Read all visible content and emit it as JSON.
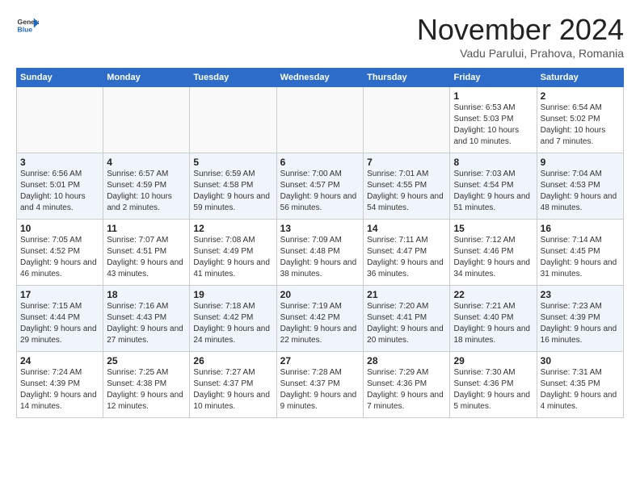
{
  "logo": {
    "general": "General",
    "blue": "Blue"
  },
  "header": {
    "month": "November 2024",
    "location": "Vadu Parului, Prahova, Romania"
  },
  "weekdays": [
    "Sunday",
    "Monday",
    "Tuesday",
    "Wednesday",
    "Thursday",
    "Friday",
    "Saturday"
  ],
  "weeks": [
    [
      {
        "day": "",
        "info": ""
      },
      {
        "day": "",
        "info": ""
      },
      {
        "day": "",
        "info": ""
      },
      {
        "day": "",
        "info": ""
      },
      {
        "day": "",
        "info": ""
      },
      {
        "day": "1",
        "info": "Sunrise: 6:53 AM\nSunset: 5:03 PM\nDaylight: 10 hours and 10 minutes."
      },
      {
        "day": "2",
        "info": "Sunrise: 6:54 AM\nSunset: 5:02 PM\nDaylight: 10 hours and 7 minutes."
      }
    ],
    [
      {
        "day": "3",
        "info": "Sunrise: 6:56 AM\nSunset: 5:01 PM\nDaylight: 10 hours and 4 minutes."
      },
      {
        "day": "4",
        "info": "Sunrise: 6:57 AM\nSunset: 4:59 PM\nDaylight: 10 hours and 2 minutes."
      },
      {
        "day": "5",
        "info": "Sunrise: 6:59 AM\nSunset: 4:58 PM\nDaylight: 9 hours and 59 minutes."
      },
      {
        "day": "6",
        "info": "Sunrise: 7:00 AM\nSunset: 4:57 PM\nDaylight: 9 hours and 56 minutes."
      },
      {
        "day": "7",
        "info": "Sunrise: 7:01 AM\nSunset: 4:55 PM\nDaylight: 9 hours and 54 minutes."
      },
      {
        "day": "8",
        "info": "Sunrise: 7:03 AM\nSunset: 4:54 PM\nDaylight: 9 hours and 51 minutes."
      },
      {
        "day": "9",
        "info": "Sunrise: 7:04 AM\nSunset: 4:53 PM\nDaylight: 9 hours and 48 minutes."
      }
    ],
    [
      {
        "day": "10",
        "info": "Sunrise: 7:05 AM\nSunset: 4:52 PM\nDaylight: 9 hours and 46 minutes."
      },
      {
        "day": "11",
        "info": "Sunrise: 7:07 AM\nSunset: 4:51 PM\nDaylight: 9 hours and 43 minutes."
      },
      {
        "day": "12",
        "info": "Sunrise: 7:08 AM\nSunset: 4:49 PM\nDaylight: 9 hours and 41 minutes."
      },
      {
        "day": "13",
        "info": "Sunrise: 7:09 AM\nSunset: 4:48 PM\nDaylight: 9 hours and 38 minutes."
      },
      {
        "day": "14",
        "info": "Sunrise: 7:11 AM\nSunset: 4:47 PM\nDaylight: 9 hours and 36 minutes."
      },
      {
        "day": "15",
        "info": "Sunrise: 7:12 AM\nSunset: 4:46 PM\nDaylight: 9 hours and 34 minutes."
      },
      {
        "day": "16",
        "info": "Sunrise: 7:14 AM\nSunset: 4:45 PM\nDaylight: 9 hours and 31 minutes."
      }
    ],
    [
      {
        "day": "17",
        "info": "Sunrise: 7:15 AM\nSunset: 4:44 PM\nDaylight: 9 hours and 29 minutes."
      },
      {
        "day": "18",
        "info": "Sunrise: 7:16 AM\nSunset: 4:43 PM\nDaylight: 9 hours and 27 minutes."
      },
      {
        "day": "19",
        "info": "Sunrise: 7:18 AM\nSunset: 4:42 PM\nDaylight: 9 hours and 24 minutes."
      },
      {
        "day": "20",
        "info": "Sunrise: 7:19 AM\nSunset: 4:42 PM\nDaylight: 9 hours and 22 minutes."
      },
      {
        "day": "21",
        "info": "Sunrise: 7:20 AM\nSunset: 4:41 PM\nDaylight: 9 hours and 20 minutes."
      },
      {
        "day": "22",
        "info": "Sunrise: 7:21 AM\nSunset: 4:40 PM\nDaylight: 9 hours and 18 minutes."
      },
      {
        "day": "23",
        "info": "Sunrise: 7:23 AM\nSunset: 4:39 PM\nDaylight: 9 hours and 16 minutes."
      }
    ],
    [
      {
        "day": "24",
        "info": "Sunrise: 7:24 AM\nSunset: 4:39 PM\nDaylight: 9 hours and 14 minutes."
      },
      {
        "day": "25",
        "info": "Sunrise: 7:25 AM\nSunset: 4:38 PM\nDaylight: 9 hours and 12 minutes."
      },
      {
        "day": "26",
        "info": "Sunrise: 7:27 AM\nSunset: 4:37 PM\nDaylight: 9 hours and 10 minutes."
      },
      {
        "day": "27",
        "info": "Sunrise: 7:28 AM\nSunset: 4:37 PM\nDaylight: 9 hours and 9 minutes."
      },
      {
        "day": "28",
        "info": "Sunrise: 7:29 AM\nSunset: 4:36 PM\nDaylight: 9 hours and 7 minutes."
      },
      {
        "day": "29",
        "info": "Sunrise: 7:30 AM\nSunset: 4:36 PM\nDaylight: 9 hours and 5 minutes."
      },
      {
        "day": "30",
        "info": "Sunrise: 7:31 AM\nSunset: 4:35 PM\nDaylight: 9 hours and 4 minutes."
      }
    ]
  ]
}
